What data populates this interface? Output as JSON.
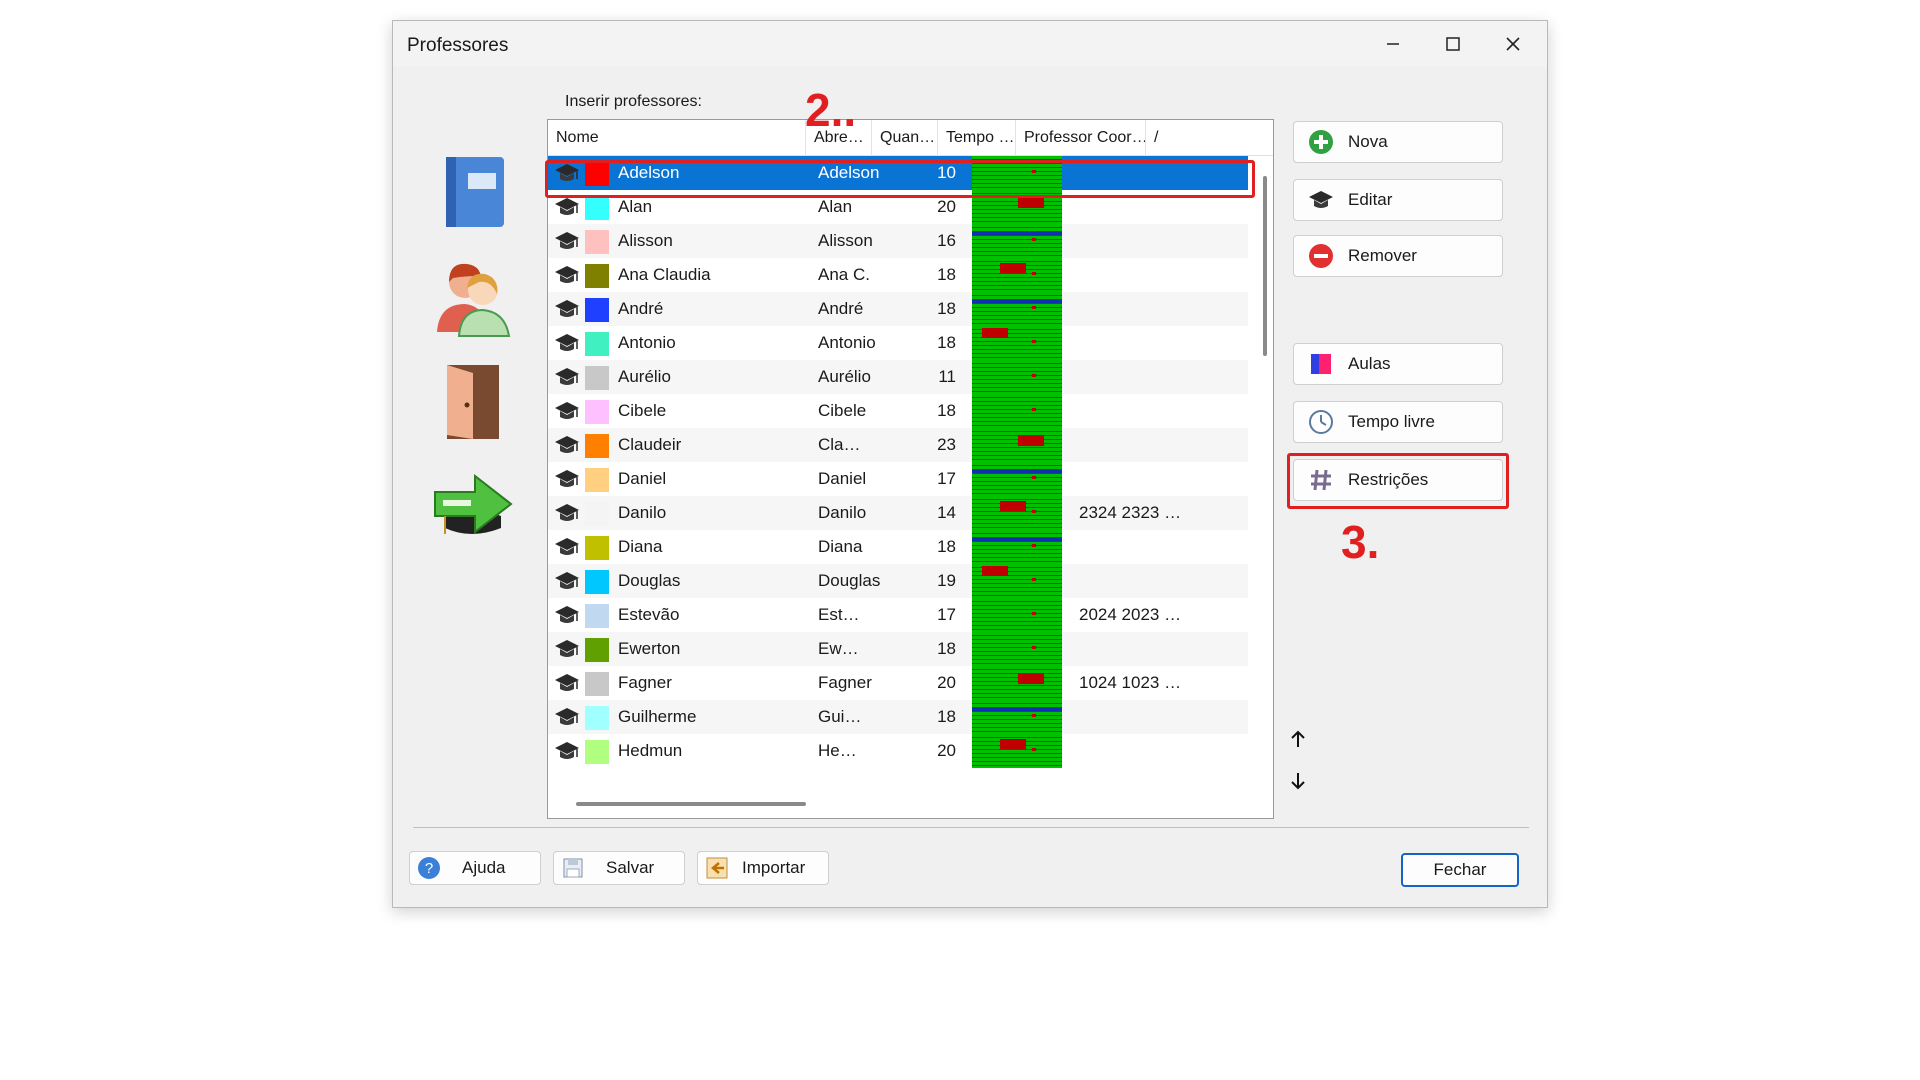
{
  "window": {
    "title": "Professores"
  },
  "list": {
    "label": "Inserir professores:",
    "columns": [
      "Nome",
      "Abre…",
      "Quan…",
      "Tempo …",
      "Professor Coor…",
      "/"
    ],
    "rows": [
      {
        "name": "Adelson",
        "abbr": "Adelson",
        "qty": "10",
        "coord": "",
        "color": "#ff0000",
        "selected": true
      },
      {
        "name": "Alan",
        "abbr": "Alan",
        "qty": "20",
        "coord": "",
        "color": "#33ffff"
      },
      {
        "name": "Alisson",
        "abbr": "Alisson",
        "qty": "16",
        "coord": "",
        "color": "#ffc0c0"
      },
      {
        "name": "Ana Claudia",
        "abbr": "Ana C.",
        "qty": "18",
        "coord": "",
        "color": "#808000"
      },
      {
        "name": "André",
        "abbr": "André",
        "qty": "18",
        "coord": "",
        "color": "#2040ff"
      },
      {
        "name": "Antonio",
        "abbr": "Antonio",
        "qty": "18",
        "coord": "",
        "color": "#40f0c0"
      },
      {
        "name": "Aurélio",
        "abbr": "Aurélio",
        "qty": "11",
        "coord": "",
        "color": "#c8c8c8"
      },
      {
        "name": "Cibele",
        "abbr": "Cibele",
        "qty": "18",
        "coord": "",
        "color": "#ffc0ff"
      },
      {
        "name": "Claudeir",
        "abbr": "Cla…",
        "qty": "23",
        "coord": "",
        "color": "#ff8000"
      },
      {
        "name": "Daniel",
        "abbr": "Daniel",
        "qty": "17",
        "coord": "",
        "color": "#ffd080"
      },
      {
        "name": "Danilo",
        "abbr": "Danilo",
        "qty": "14",
        "coord": "2324  2323  …",
        "color": "#f4f4f4"
      },
      {
        "name": "Diana",
        "abbr": "Diana",
        "qty": "18",
        "coord": "",
        "color": "#c0c000"
      },
      {
        "name": "Douglas",
        "abbr": "Douglas",
        "qty": "19",
        "coord": "",
        "color": "#00c8ff"
      },
      {
        "name": "Estevão",
        "abbr": "Est…",
        "qty": "17",
        "coord": "2024  2023  …",
        "color": "#c0d8f0"
      },
      {
        "name": "Ewerton",
        "abbr": "Ew…",
        "qty": "18",
        "coord": "",
        "color": "#60a000"
      },
      {
        "name": "Fagner",
        "abbr": "Fagner",
        "qty": "20",
        "coord": "1024  1023  …",
        "color": "#c8c8c8"
      },
      {
        "name": "Guilherme",
        "abbr": "Gui…",
        "qty": "18",
        "coord": "",
        "color": "#a0ffff"
      },
      {
        "name": "Hedmun",
        "abbr": "He…",
        "qty": "20",
        "coord": "",
        "color": "#b0ff80"
      }
    ]
  },
  "actions": {
    "nova": "Nova",
    "editar": "Editar",
    "remover": "Remover",
    "aulas": "Aulas",
    "tempo_livre": "Tempo livre",
    "restricoes": "Restrições"
  },
  "footer": {
    "ajuda": "Ajuda",
    "salvar": "Salvar",
    "importar": "Importar",
    "fechar": "Fechar"
  },
  "annotations": {
    "step2": "2..",
    "step3": "3."
  },
  "colors": {
    "selection": "#0a74d4",
    "annotation": "#e02020",
    "accent": "#1464c8"
  }
}
